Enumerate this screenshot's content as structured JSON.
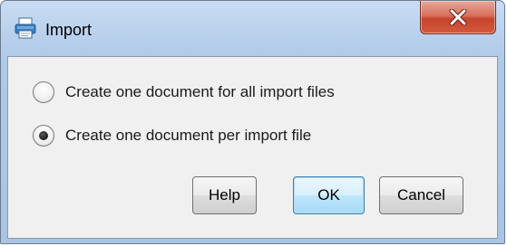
{
  "dialog": {
    "title": "Import",
    "icon": "printer-icon",
    "close_icon": "close-x-icon"
  },
  "options": [
    {
      "label": "Create one document for all import files",
      "selected": false
    },
    {
      "label": "Create one document per import file",
      "selected": true
    }
  ],
  "buttons": {
    "help": "Help",
    "ok": "OK",
    "cancel": "Cancel"
  },
  "colors": {
    "close_button": "#c6442d",
    "default_button_border": "#3c7fb1",
    "content_background": "#f0f0f0"
  }
}
